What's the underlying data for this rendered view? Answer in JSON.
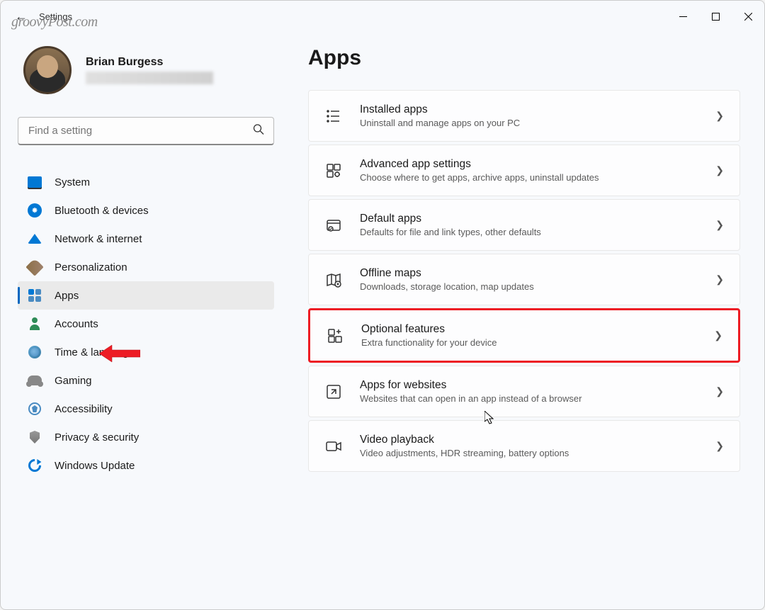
{
  "watermark": "groovyPost.com",
  "window": {
    "title": "Settings"
  },
  "profile": {
    "name": "Brian Burgess"
  },
  "search": {
    "placeholder": "Find a setting"
  },
  "nav": {
    "items": [
      {
        "label": "System",
        "icon": "system"
      },
      {
        "label": "Bluetooth & devices",
        "icon": "bluetooth"
      },
      {
        "label": "Network & internet",
        "icon": "network"
      },
      {
        "label": "Personalization",
        "icon": "personalization"
      },
      {
        "label": "Apps",
        "icon": "apps",
        "active": true
      },
      {
        "label": "Accounts",
        "icon": "accounts"
      },
      {
        "label": "Time & language",
        "icon": "time"
      },
      {
        "label": "Gaming",
        "icon": "gaming"
      },
      {
        "label": "Accessibility",
        "icon": "accessibility"
      },
      {
        "label": "Privacy & security",
        "icon": "privacy"
      },
      {
        "label": "Windows Update",
        "icon": "update"
      }
    ]
  },
  "page": {
    "title": "Apps"
  },
  "cards": [
    {
      "title": "Installed apps",
      "desc": "Uninstall and manage apps on your PC",
      "icon": "installed-apps-icon"
    },
    {
      "title": "Advanced app settings",
      "desc": "Choose where to get apps, archive apps, uninstall updates",
      "icon": "advanced-settings-icon"
    },
    {
      "title": "Default apps",
      "desc": "Defaults for file and link types, other defaults",
      "icon": "default-apps-icon"
    },
    {
      "title": "Offline maps",
      "desc": "Downloads, storage location, map updates",
      "icon": "offline-maps-icon"
    },
    {
      "title": "Optional features",
      "desc": "Extra functionality for your device",
      "icon": "optional-features-icon",
      "highlighted": true
    },
    {
      "title": "Apps for websites",
      "desc": "Websites that can open in an app instead of a browser",
      "icon": "apps-websites-icon"
    },
    {
      "title": "Video playback",
      "desc": "Video adjustments, HDR streaming, battery options",
      "icon": "video-playback-icon"
    }
  ]
}
